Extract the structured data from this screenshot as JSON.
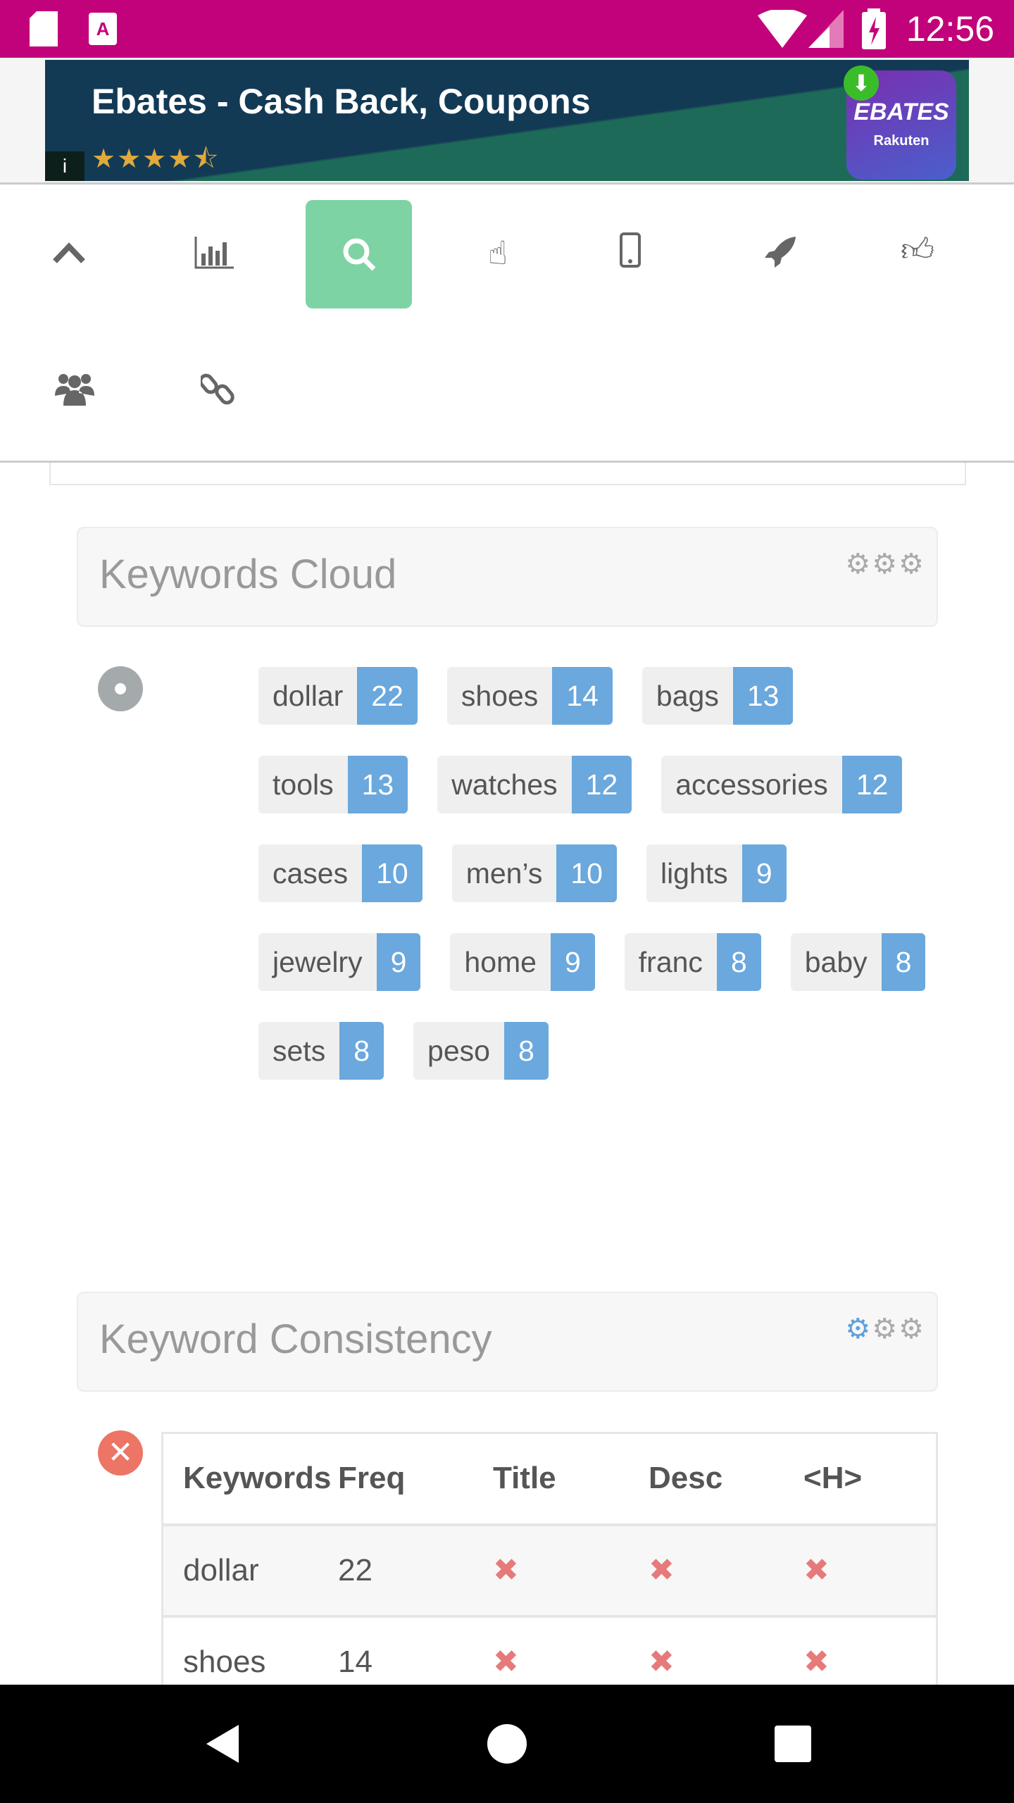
{
  "status_bar": {
    "time": "12:56",
    "icons": [
      "sd-card-icon",
      "a-app-icon",
      "wifi-icon",
      "signal-icon",
      "battery-charging-icon"
    ]
  },
  "ad": {
    "title": "Ebates - Cash Back, Coupons",
    "rating": 4.5,
    "stars": "★★★★⯪",
    "info": "i",
    "logo_text": "EBATES",
    "logo_sub": "Rakuten"
  },
  "nav_icons": [
    "chevron-up-icon",
    "bar-chart-icon",
    "search-icon",
    "pointer-hand-icon",
    "mobile-phone-icon",
    "rocket-icon",
    "thumbs-up-icon",
    "users-icon",
    "link-icon"
  ],
  "nav_active": "search-icon",
  "keywords_cloud": {
    "title": "Keywords Cloud",
    "gears_active": 0,
    "tags": [
      {
        "word": "dollar",
        "count": "22"
      },
      {
        "word": "shoes",
        "count": "14"
      },
      {
        "word": "bags",
        "count": "13"
      },
      {
        "word": "tools",
        "count": "13"
      },
      {
        "word": "watches",
        "count": "12"
      },
      {
        "word": "accessories",
        "count": "12"
      },
      {
        "word": "cases",
        "count": "10"
      },
      {
        "word": "men’s",
        "count": "10"
      },
      {
        "word": "lights",
        "count": "9"
      },
      {
        "word": "jewelry",
        "count": "9"
      },
      {
        "word": "home",
        "count": "9"
      },
      {
        "word": "franc",
        "count": "8"
      },
      {
        "word": "baby",
        "count": "8"
      },
      {
        "word": "sets",
        "count": "8"
      },
      {
        "word": "peso",
        "count": "8"
      }
    ]
  },
  "keyword_consistency": {
    "title": "Keyword Consistency",
    "gears_active": 1,
    "headers": [
      "Keywords",
      "Freq",
      "Title",
      "Desc",
      "<H>"
    ],
    "rows": [
      {
        "keyword": "dollar",
        "freq": "22",
        "title": "✖",
        "desc": "✖",
        "h": "✖"
      },
      {
        "keyword": "shoes",
        "freq": "14",
        "title": "✖",
        "desc": "✖",
        "h": "✖"
      }
    ]
  },
  "colors": {
    "status_bar": "#c2027a",
    "active_tab": "#7dd3a3",
    "tag_count": "#6aa8dd",
    "error": "#ec7565"
  }
}
